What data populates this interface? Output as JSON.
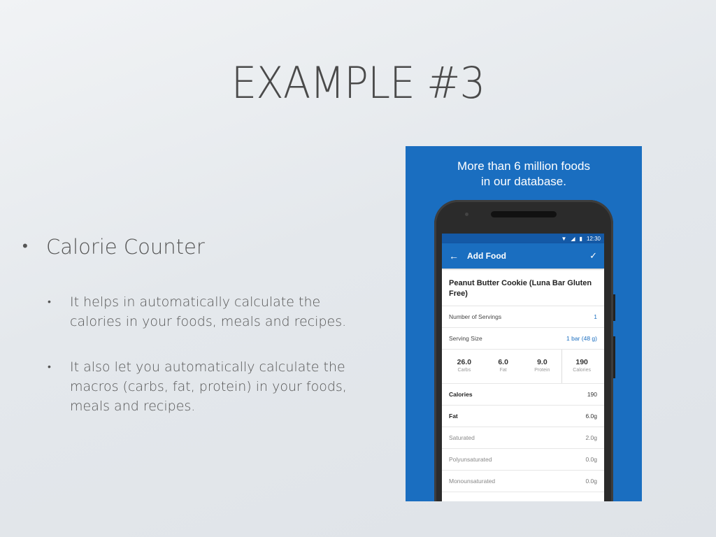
{
  "slide": {
    "title": "EXAMPLE #3",
    "main_bullet": "Calorie Counter",
    "sub_bullets": [
      "It helps in automatically calculate the calories in your foods, meals and recipes.",
      "It also let you automatically calculate the macros (carbs, fat, protein) in your foods, meals and recipes."
    ]
  },
  "promo": {
    "caption_line1": "More than 6 million foods",
    "caption_line2": "in our database.",
    "status_time": "12:30",
    "appbar": {
      "back": "←",
      "title": "Add Food",
      "confirm": "✓"
    },
    "food_name": "Peanut Butter Cookie (Luna Bar Gluten Free)",
    "servings": {
      "label": "Number of Servings",
      "value": "1"
    },
    "serving_size": {
      "label": "Serving Size",
      "value": "1 bar (48 g)"
    },
    "macros": [
      {
        "value": "26.0",
        "label": "Carbs"
      },
      {
        "value": "6.0",
        "label": "Fat"
      },
      {
        "value": "9.0",
        "label": "Protein"
      },
      {
        "value": "190",
        "label": "Calories"
      }
    ],
    "nutrients": [
      {
        "label": "Calories",
        "value": "190"
      },
      {
        "label": "Fat",
        "value": "6.0g"
      },
      {
        "label": "Saturated",
        "value": "2.0g"
      },
      {
        "label": "Polyunsaturated",
        "value": "0.0g"
      },
      {
        "label": "Monounsaturated",
        "value": "0.0g"
      }
    ],
    "colors": {
      "brand_blue": "#1a6ec0"
    }
  }
}
